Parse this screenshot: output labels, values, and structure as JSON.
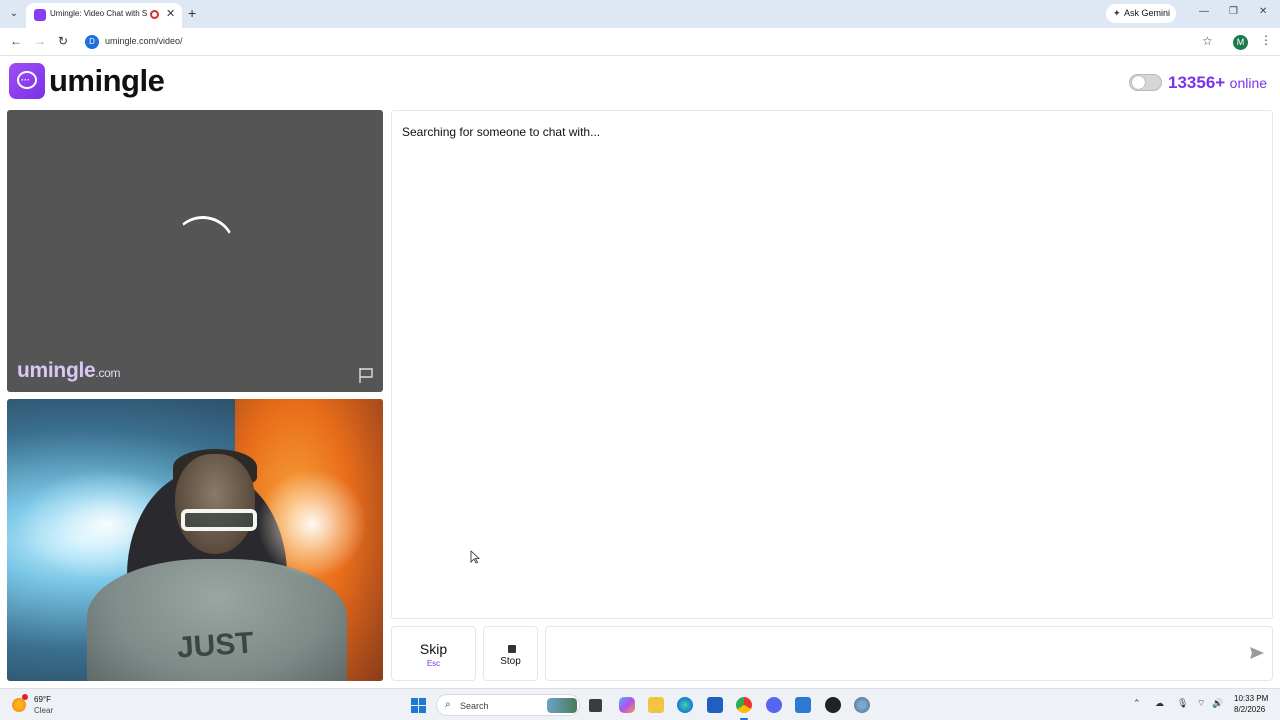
{
  "browser": {
    "tab_title": "Umingle: Video Chat with S",
    "tab_close": "✕",
    "new_tab": "+",
    "gemini_label": "Ask Gemini",
    "url": "umingle.com/video/",
    "site_badge": "D",
    "profile_initial": "M",
    "window_controls": [
      "—",
      "❐",
      "✕"
    ]
  },
  "header": {
    "logo_text": "umingle",
    "online_count": "13356+",
    "online_label": "online",
    "toggle_on": false
  },
  "stranger_video": {
    "watermark": "umingle",
    "watermark_suffix": ".com",
    "state": "loading"
  },
  "self_video": {
    "shirt_text": "JUST"
  },
  "chat": {
    "status": "Searching for someone to chat with...",
    "input_placeholder": ""
  },
  "controls": {
    "skip_label": "Skip",
    "skip_hint": "Esc",
    "stop_label": "Stop"
  },
  "taskbar": {
    "weather_temp": "69°F",
    "weather_desc": "Clear",
    "search_label": "Search",
    "time": "10:33 PM",
    "date": "8/2/2026",
    "apps": [
      "file-explorer",
      "copilot",
      "folder",
      "edge",
      "store",
      "chrome",
      "discord",
      "remote-desktop",
      "app",
      "settings"
    ]
  },
  "colors": {
    "brand": "#7a33e8",
    "video_bg": "#555555",
    "tabstrip": "#dee8f5"
  }
}
